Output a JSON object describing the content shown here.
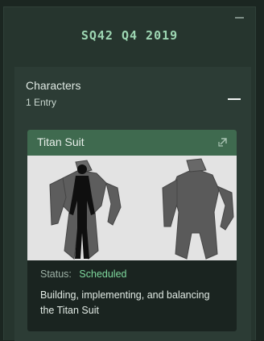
{
  "roadmap": {
    "quarter_title": "SQ42 Q4 2019"
  },
  "category": {
    "title": "Characters",
    "entry_count": "1 Entry"
  },
  "card": {
    "title": "Titan Suit",
    "status_label": "Status:",
    "status_value": "Scheduled",
    "description": "Building, implementing, and balancing the Titan Suit",
    "external_icon": "external-link-icon"
  },
  "colors": {
    "accent_green": "#7fd99e",
    "header_green": "#3f6a4f",
    "title_green": "#9ed7b3"
  }
}
